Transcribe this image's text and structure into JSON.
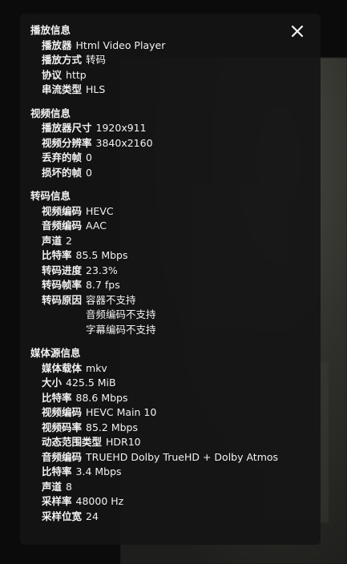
{
  "close_icon": "close-icon",
  "sections": [
    {
      "title": "播放信息",
      "rows": [
        {
          "label": "播放器",
          "values": [
            "Html Video Player"
          ]
        },
        {
          "label": "播放方式",
          "values": [
            "转码"
          ]
        },
        {
          "label": "协议",
          "values": [
            "http"
          ]
        },
        {
          "label": "串流类型",
          "values": [
            "HLS"
          ]
        }
      ]
    },
    {
      "title": "视频信息",
      "rows": [
        {
          "label": "播放器尺寸",
          "values": [
            "1920x911"
          ]
        },
        {
          "label": "视频分辨率",
          "values": [
            "3840x2160"
          ]
        },
        {
          "label": "丢弃的帧",
          "values": [
            "0"
          ]
        },
        {
          "label": "损坏的帧",
          "values": [
            "0"
          ]
        }
      ]
    },
    {
      "title": "转码信息",
      "rows": [
        {
          "label": "视频编码",
          "values": [
            "HEVC"
          ]
        },
        {
          "label": "音频编码",
          "values": [
            "AAC"
          ]
        },
        {
          "label": "声道",
          "values": [
            "2"
          ]
        },
        {
          "label": "比特率",
          "values": [
            "85.5 Mbps"
          ]
        },
        {
          "label": "转码进度",
          "values": [
            "23.3%"
          ]
        },
        {
          "label": "转码帧率",
          "values": [
            "8.7 fps"
          ]
        },
        {
          "label": "转码原因",
          "values": [
            "容器不支持",
            "音频编码不支持",
            "字幕编码不支持"
          ]
        }
      ]
    },
    {
      "title": "媒体源信息",
      "rows": [
        {
          "label": "媒体载体",
          "values": [
            "mkv"
          ]
        },
        {
          "label": "大小",
          "values": [
            "425.5 MiB"
          ]
        },
        {
          "label": "比特率",
          "values": [
            "88.6 Mbps"
          ]
        },
        {
          "label": "视频编码",
          "values": [
            "HEVC Main 10"
          ]
        },
        {
          "label": "视频码率",
          "values": [
            "85.2 Mbps"
          ]
        },
        {
          "label": "动态范围类型",
          "values": [
            "HDR10"
          ]
        },
        {
          "label": "音频编码",
          "values": [
            "TRUEHD Dolby TrueHD + Dolby Atmos"
          ]
        },
        {
          "label": "比特率",
          "values": [
            "3.4 Mbps"
          ]
        },
        {
          "label": "声道",
          "values": [
            "8"
          ]
        },
        {
          "label": "采样率",
          "values": [
            "48000 Hz"
          ]
        },
        {
          "label": "采样位宽",
          "values": [
            "24"
          ]
        }
      ]
    }
  ]
}
